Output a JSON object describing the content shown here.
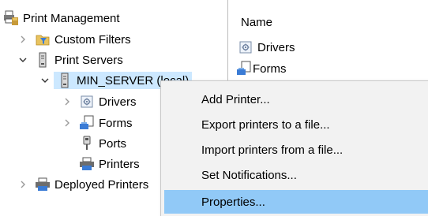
{
  "tree": {
    "root": {
      "label": "Print Management"
    },
    "custom_filters": {
      "label": "Custom Filters"
    },
    "print_servers": {
      "label": "Print Servers"
    },
    "server": {
      "label": "MIN_SERVER (local)"
    },
    "drivers": {
      "label": "Drivers"
    },
    "forms": {
      "label": "Forms"
    },
    "ports": {
      "label": "Ports"
    },
    "printers": {
      "label": "Printers"
    },
    "deployed_printers": {
      "label": "Deployed Printers"
    }
  },
  "list": {
    "column_name": "Name",
    "items": [
      {
        "label": "Drivers",
        "icon": "drivers-icon"
      },
      {
        "label": "Forms",
        "icon": "forms-icon"
      }
    ]
  },
  "context_menu": {
    "items": [
      {
        "label": "Add Printer..."
      },
      {
        "label": "Export printers to a file..."
      },
      {
        "label": "Import printers from a file..."
      },
      {
        "label": "Set Notifications..."
      },
      {
        "label": "Properties...",
        "highlighted": true
      }
    ]
  },
  "colors": {
    "selection": "#cce8ff",
    "menu_highlight": "#91c9f7",
    "menu_background": "#f2f2f2"
  }
}
